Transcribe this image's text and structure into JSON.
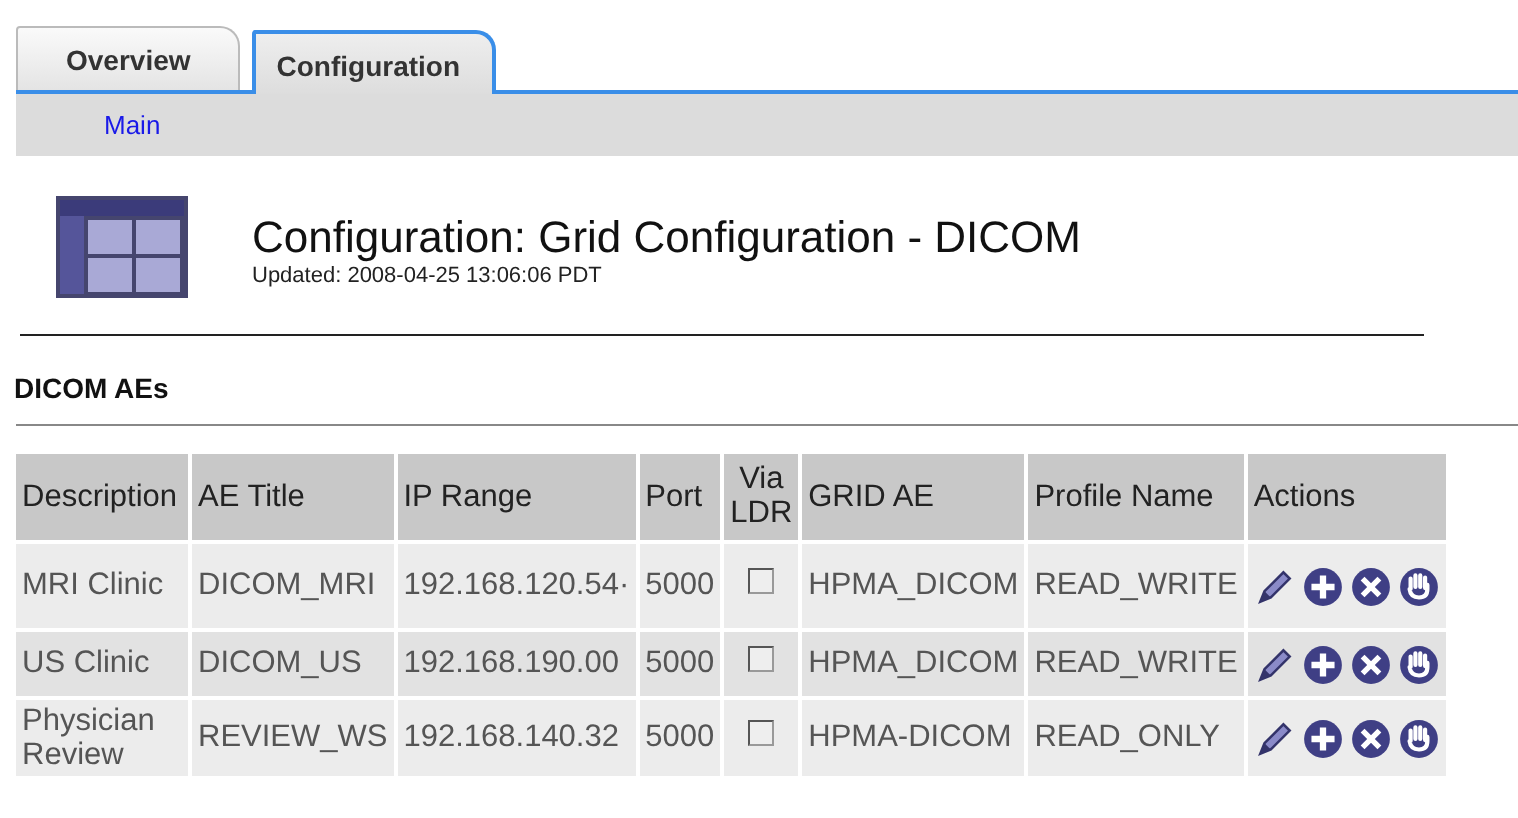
{
  "tabs": [
    {
      "label": "Overview",
      "selected": false
    },
    {
      "label": "Configuration",
      "selected": true
    }
  ],
  "subnav": [
    {
      "label": "Main"
    }
  ],
  "header": {
    "title": "Configuration: Grid Configuration - DICOM",
    "updated": "Updated: 2008-04-25 13:06:06 PDT"
  },
  "section": {
    "title": "DICOM AEs"
  },
  "table": {
    "columns": [
      "Description",
      "AE Title",
      "IP Range",
      "Port",
      "Via LDR",
      "GRID AE",
      "Profile Name",
      "Actions"
    ],
    "rows": [
      {
        "description": "MRI Clinic",
        "ae_title": "DICOM_MRI",
        "ip_range": "192.168.120.54·",
        "port": "5000",
        "via_ldr": false,
        "grid_ae": "HPMA_DICOM",
        "profile": "READ_WRITE"
      },
      {
        "description": "US Clinic",
        "ae_title": "DICOM_US",
        "ip_range": "192.168.190.00",
        "port": "5000",
        "via_ldr": false,
        "grid_ae": "HPMA_DICOM",
        "profile": "READ_WRITE"
      },
      {
        "description": "Physician Review",
        "ae_title": "REVIEW_WS",
        "ip_range": "192.168.140.32",
        "port": "5000",
        "via_ldr": false,
        "grid_ae": "HPMA-DICOM",
        "profile": "READ_ONLY"
      }
    ]
  }
}
